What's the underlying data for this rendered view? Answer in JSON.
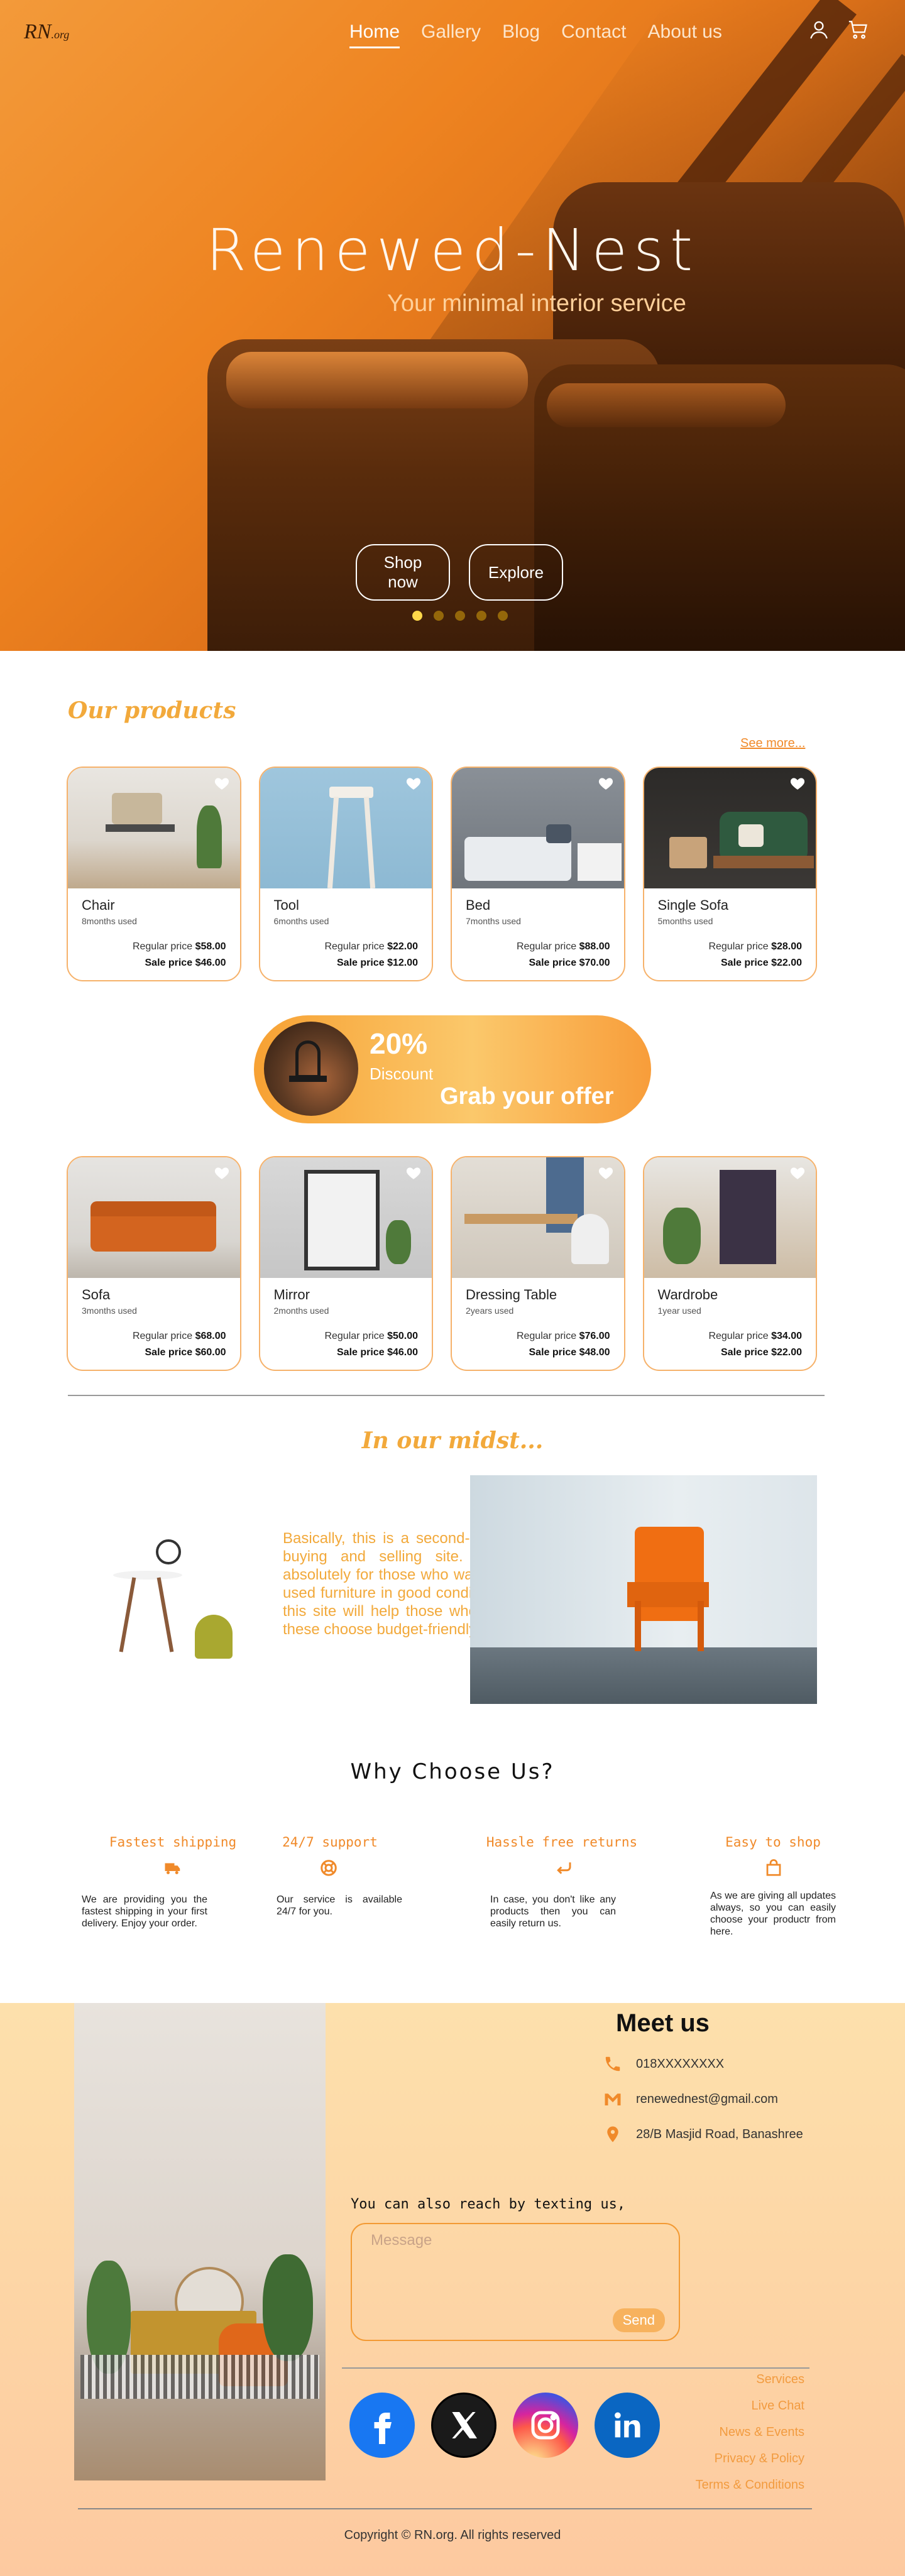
{
  "nav": {
    "logo": "RN",
    "logo_suffix": ".org",
    "items": [
      {
        "label": "Home",
        "active": true
      },
      {
        "label": "Gallery",
        "active": false
      },
      {
        "label": "Blog",
        "active": false
      },
      {
        "label": "Contact",
        "active": false
      },
      {
        "label": "About us",
        "active": false
      }
    ],
    "icons": [
      "user-icon",
      "cart-icon"
    ]
  },
  "hero": {
    "title": "Renewed-Nest",
    "subtitle": "Your minimal interior service",
    "buttons": [
      "Shop now",
      "Explore"
    ],
    "slides": 5,
    "active_slide": 0
  },
  "products": {
    "title": "Our products",
    "see_more": "See more...",
    "row1": [
      {
        "name": "Chair",
        "used": "8months used",
        "regular_label": "Regular price",
        "regular": "$58.00",
        "sale_label": "Sale price",
        "sale": "$46.00"
      },
      {
        "name": "Tool",
        "used": "6months used",
        "regular_label": "Regular price",
        "regular": "$22.00",
        "sale_label": "Sale price",
        "sale": "$12.00"
      },
      {
        "name": "Bed",
        "used": "7months used",
        "regular_label": "Regular price",
        "regular": "$88.00",
        "sale_label": "Sale price",
        "sale": "$70.00"
      },
      {
        "name": "Single Sofa",
        "used": "5months used",
        "regular_label": "Regular price",
        "regular": "$28.00",
        "sale_label": "Sale price",
        "sale": "$22.00"
      }
    ],
    "row2": [
      {
        "name": "Sofa",
        "used": "3months used",
        "regular_label": "Regular price",
        "regular": "$68.00",
        "sale_label": "Sale price",
        "sale": "$60.00"
      },
      {
        "name": "Mirror",
        "used": "2months used",
        "regular_label": "Regular price",
        "regular": "$50.00",
        "sale_label": "Sale price",
        "sale": "$46.00"
      },
      {
        "name": "Dressing Table",
        "used": "2years used",
        "regular_label": "Regular price",
        "regular": "$76.00",
        "sale_label": "Sale price",
        "sale": "$48.00"
      },
      {
        "name": "Wardrobe",
        "used": "1year used",
        "regular_label": "Regular price",
        "regular": "$34.00",
        "sale_label": "Sale price",
        "sale": "$22.00"
      }
    ]
  },
  "discount": {
    "percent": "20%",
    "label": "Discount",
    "cta": "Grab your offer"
  },
  "midst": {
    "title": "In our midst...",
    "text": "Basically, this is a second-hand furniture buying and selling site. This site is absolutely for those who want to sell their used furniture in good condition. Similarly, this site will help those who want to buy these choose budget-friendly products."
  },
  "why": {
    "title": "Why Choose Us?",
    "items": [
      {
        "head": "Fastest shipping",
        "icon": "truck-icon",
        "desc": "We are providing you the fastest shipping in your first delivery. Enjoy your order."
      },
      {
        "head": "24/7 support",
        "icon": "lifebuoy-icon",
        "desc": "Our service is available 24/7 for you."
      },
      {
        "head": "Hassle free returns",
        "icon": "return-arrow-icon",
        "desc": "In case, you don't like any products then you can easily return us."
      },
      {
        "head": "Easy to shop",
        "icon": "shopping-bag-icon",
        "desc": "As we are giving all updates always, so you can easily choose your productr from here."
      }
    ]
  },
  "footer": {
    "meet": "Meet us",
    "phone": "018XXXXXXXX",
    "email": "renewednest@gmail.com",
    "address": "28/B Masjid Road, Banashree",
    "reach": "You can also reach by texting us,",
    "message_placeholder": "Message",
    "send": "Send",
    "social": [
      "facebook-icon",
      "x-icon",
      "instagram-icon",
      "linkedin-icon"
    ],
    "links": [
      "Services",
      "Live Chat",
      "News & Events",
      "Privacy & Policy",
      "Terms & Conditions"
    ],
    "copyright": "Copyright © RN.org. All rights reserved"
  },
  "colors": {
    "accent": "#f08a2a",
    "accent_light": "#f2a93b",
    "footer_bg": "#fdd3a4"
  }
}
